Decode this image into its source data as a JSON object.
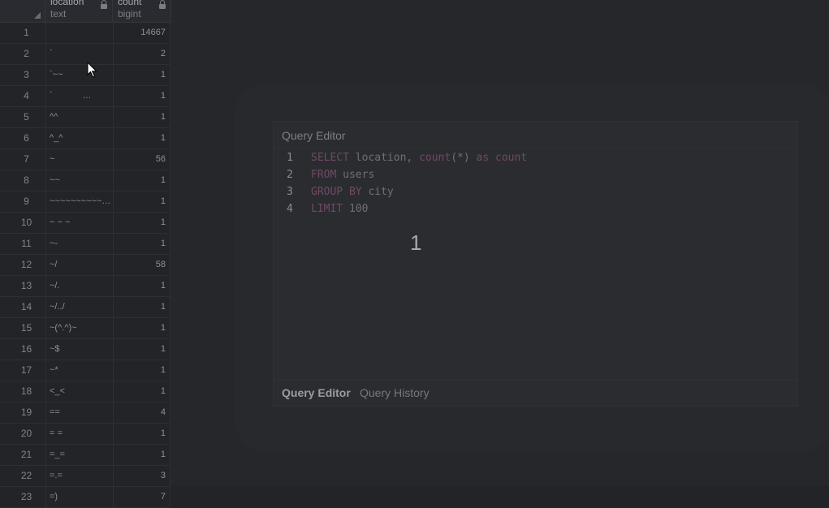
{
  "grid": {
    "columns": [
      {
        "name": "location",
        "type": "text"
      },
      {
        "name": "count",
        "type": "bigint"
      }
    ],
    "rows": [
      {
        "n": "1",
        "location": "",
        "count": "14667"
      },
      {
        "n": "2",
        "location": "`",
        "count": "2"
      },
      {
        "n": "3",
        "location": "`~~",
        "count": "1"
      },
      {
        "n": "4",
        "location": "`            …",
        "count": "1"
      },
      {
        "n": "5",
        "location": "^^",
        "count": "1"
      },
      {
        "n": "6",
        "location": "^_^",
        "count": "1"
      },
      {
        "n": "7",
        "location": "~",
        "count": "56"
      },
      {
        "n": "8",
        "location": "~~",
        "count": "1"
      },
      {
        "n": "9",
        "location": "~~~~~~~~~~…",
        "count": "1"
      },
      {
        "n": "10",
        "location": "~ ~ ~",
        "count": "1"
      },
      {
        "n": "11",
        "location": "~-",
        "count": "1"
      },
      {
        "n": "12",
        "location": "~/",
        "count": "58"
      },
      {
        "n": "13",
        "location": "~/.",
        "count": "1"
      },
      {
        "n": "14",
        "location": "~/../",
        "count": "1"
      },
      {
        "n": "15",
        "location": "~(^.^)~",
        "count": "1"
      },
      {
        "n": "16",
        "location": "~$",
        "count": "1"
      },
      {
        "n": "17",
        "location": "~*",
        "count": "1"
      },
      {
        "n": "18",
        "location": "<_<",
        "count": "1"
      },
      {
        "n": "19",
        "location": "==",
        "count": "4"
      },
      {
        "n": "20",
        "location": "= =",
        "count": "1"
      },
      {
        "n": "21",
        "location": "=_=",
        "count": "1"
      },
      {
        "n": "22",
        "location": "=.=",
        "count": "3"
      },
      {
        "n": "23",
        "location": "=)",
        "count": "7"
      }
    ]
  },
  "editor": {
    "title": "Query Editor",
    "lines": [
      {
        "n": "1",
        "tokens": [
          {
            "t": "SELECT",
            "k": "kw"
          },
          {
            "t": " location, ",
            "k": "id"
          },
          {
            "t": "count",
            "k": "kw"
          },
          {
            "t": "(*) ",
            "k": "id"
          },
          {
            "t": "as",
            "k": "kw"
          },
          {
            "t": " ",
            "k": "id"
          },
          {
            "t": "count",
            "k": "kw"
          }
        ]
      },
      {
        "n": "2",
        "tokens": [
          {
            "t": "FROM",
            "k": "kw"
          },
          {
            "t": " users",
            "k": "id"
          }
        ]
      },
      {
        "n": "3",
        "tokens": [
          {
            "t": "GROUP BY",
            "k": "kw"
          },
          {
            "t": " city",
            "k": "id"
          }
        ]
      },
      {
        "n": "4",
        "tokens": [
          {
            "t": "LIMIT",
            "k": "kw"
          },
          {
            "t": " 100",
            "k": "id"
          }
        ]
      }
    ],
    "overlay_number": "1",
    "tabs": [
      "Query Editor",
      "Query History"
    ],
    "active_tab": "Query Editor"
  }
}
